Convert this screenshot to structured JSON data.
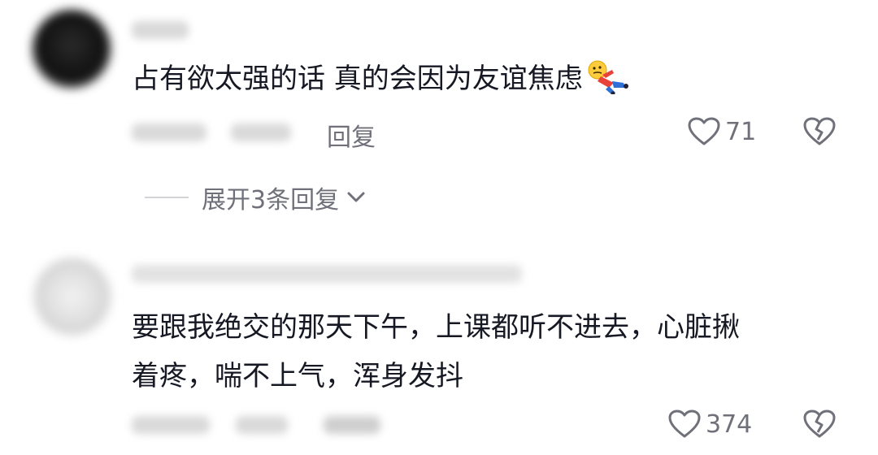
{
  "comments": [
    {
      "text": "占有欲太强的话 真的会因为友谊焦虑",
      "reply_label": "回复",
      "likes": "71",
      "expand_replies": "展开3条回复"
    },
    {
      "text_line1": "要跟我绝交的那天下午，上课都听不进去，心脏揪",
      "text_line2": "着疼，喘不上气，浑身发抖",
      "likes": "374"
    }
  ],
  "icons": {
    "like": "heart-outline-icon",
    "dislike": "broken-heart-icon",
    "expand": "chevron-down-icon",
    "emoji": "falling-person-emoji"
  },
  "colors": {
    "text": "#161823",
    "secondary": "#6f7079",
    "divider": "#d4d4d8"
  }
}
